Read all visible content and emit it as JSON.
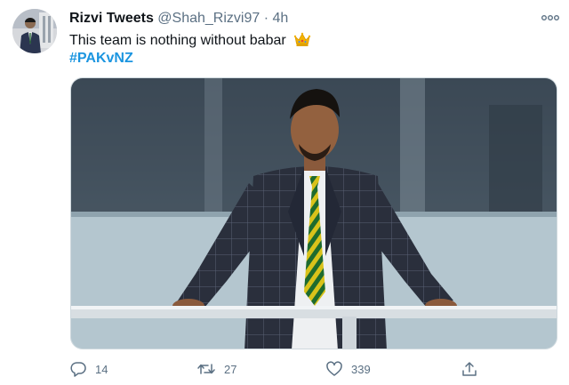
{
  "author": {
    "name": "Rizvi Tweets",
    "handle": "@Shah_Rizvi97",
    "separator": "·",
    "time": "4h"
  },
  "tweet": {
    "text": "This team is nothing without babar",
    "emoji_icon": "crown-icon",
    "hashtag": "#PAKvNZ"
  },
  "media": {
    "description_icon": "photo-of-man-in-checked-suit-leaning-on-railing"
  },
  "actions": {
    "reply_count": "14",
    "retweet_count": "27",
    "like_count": "339"
  },
  "colors": {
    "text_primary": "#0f1419",
    "text_secondary": "#5b7083",
    "accent": "#1b95e0",
    "tie_green": "#1e6b2e",
    "tie_yellow": "#d9c21a"
  }
}
